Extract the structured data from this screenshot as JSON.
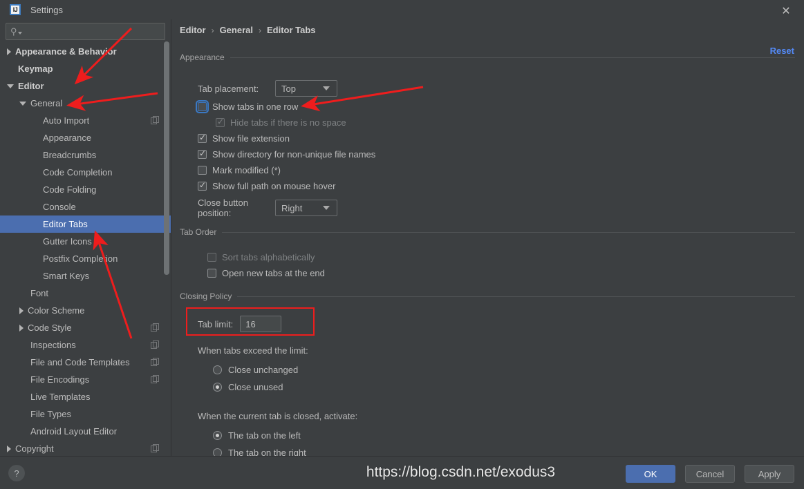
{
  "window": {
    "title": "Settings",
    "logo_text": "IJ",
    "close_icon": "close-icon"
  },
  "sidebar": {
    "search": {
      "value": "",
      "placeholder": ""
    },
    "items": [
      {
        "label": "Appearance & Behavior",
        "indent": 0,
        "twisty": "collapsed",
        "bold": true,
        "selected": false,
        "copy": false
      },
      {
        "label": "Keymap",
        "indent": 0,
        "twisty": "none",
        "bold": true,
        "selected": false,
        "copy": false
      },
      {
        "label": "Editor",
        "indent": 0,
        "twisty": "expanded",
        "bold": true,
        "selected": false,
        "copy": false
      },
      {
        "label": "General",
        "indent": 1,
        "twisty": "expanded",
        "bold": false,
        "selected": false,
        "copy": false
      },
      {
        "label": "Auto Import",
        "indent": 2,
        "twisty": "none",
        "bold": false,
        "selected": false,
        "copy": true
      },
      {
        "label": "Appearance",
        "indent": 2,
        "twisty": "none",
        "bold": false,
        "selected": false,
        "copy": false
      },
      {
        "label": "Breadcrumbs",
        "indent": 2,
        "twisty": "none",
        "bold": false,
        "selected": false,
        "copy": false
      },
      {
        "label": "Code Completion",
        "indent": 2,
        "twisty": "none",
        "bold": false,
        "selected": false,
        "copy": false
      },
      {
        "label": "Code Folding",
        "indent": 2,
        "twisty": "none",
        "bold": false,
        "selected": false,
        "copy": false
      },
      {
        "label": "Console",
        "indent": 2,
        "twisty": "none",
        "bold": false,
        "selected": false,
        "copy": false
      },
      {
        "label": "Editor Tabs",
        "indent": 2,
        "twisty": "none",
        "bold": false,
        "selected": true,
        "copy": false
      },
      {
        "label": "Gutter Icons",
        "indent": 2,
        "twisty": "none",
        "bold": false,
        "selected": false,
        "copy": false
      },
      {
        "label": "Postfix Completion",
        "indent": 2,
        "twisty": "none",
        "bold": false,
        "selected": false,
        "copy": false
      },
      {
        "label": "Smart Keys",
        "indent": 2,
        "twisty": "none",
        "bold": false,
        "selected": false,
        "copy": false
      },
      {
        "label": "Font",
        "indent": 1,
        "twisty": "none",
        "bold": false,
        "selected": false,
        "copy": false
      },
      {
        "label": "Color Scheme",
        "indent": 1,
        "twisty": "collapsed",
        "bold": false,
        "selected": false,
        "copy": false
      },
      {
        "label": "Code Style",
        "indent": 1,
        "twisty": "collapsed",
        "bold": false,
        "selected": false,
        "copy": true
      },
      {
        "label": "Inspections",
        "indent": 1,
        "twisty": "none",
        "bold": false,
        "selected": false,
        "copy": true
      },
      {
        "label": "File and Code Templates",
        "indent": 1,
        "twisty": "none",
        "bold": false,
        "selected": false,
        "copy": true
      },
      {
        "label": "File Encodings",
        "indent": 1,
        "twisty": "none",
        "bold": false,
        "selected": false,
        "copy": true
      },
      {
        "label": "Live Templates",
        "indent": 1,
        "twisty": "none",
        "bold": false,
        "selected": false,
        "copy": false
      },
      {
        "label": "File Types",
        "indent": 1,
        "twisty": "none",
        "bold": false,
        "selected": false,
        "copy": false
      },
      {
        "label": "Android Layout Editor",
        "indent": 1,
        "twisty": "none",
        "bold": false,
        "selected": false,
        "copy": false
      },
      {
        "label": "Copyright",
        "indent": 0,
        "twisty": "collapsed",
        "bold": false,
        "selected": false,
        "copy": true
      }
    ]
  },
  "content": {
    "breadcrumb": [
      "Editor",
      "General",
      "Editor Tabs"
    ],
    "breadcrumb_separator": "›",
    "reset_label": "Reset",
    "appearance": {
      "title": "Appearance",
      "tab_placement_label": "Tab placement:",
      "tab_placement_value": "Top",
      "checkboxes": [
        {
          "label": "Show tabs in one row",
          "checked": false,
          "disabled": false,
          "focused": true,
          "indent": 0
        },
        {
          "label": "Hide tabs if there is no space",
          "checked": true,
          "disabled": true,
          "focused": false,
          "indent": 1
        },
        {
          "label": "Show file extension",
          "checked": true,
          "disabled": false,
          "focused": false,
          "indent": 0
        },
        {
          "label": "Show directory for non-unique file names",
          "checked": true,
          "disabled": false,
          "focused": false,
          "indent": 0
        },
        {
          "label": "Mark modified (*)",
          "checked": false,
          "disabled": false,
          "focused": false,
          "indent": 0
        },
        {
          "label": "Show full path on mouse hover",
          "checked": true,
          "disabled": false,
          "focused": false,
          "indent": 0
        }
      ],
      "close_button_label": "Close button position:",
      "close_button_value": "Right"
    },
    "tab_order": {
      "title": "Tab Order",
      "checkboxes": [
        {
          "label": "Sort tabs alphabetically",
          "checked": false,
          "disabled": true
        },
        {
          "label": "Open new tabs at the end",
          "checked": false,
          "disabled": false
        }
      ]
    },
    "closing_policy": {
      "title": "Closing Policy",
      "tab_limit_label": "Tab limit:",
      "tab_limit_value": "16",
      "exceed_label": "When tabs exceed the limit:",
      "exceed_options": [
        {
          "label": "Close unchanged",
          "selected": false
        },
        {
          "label": "Close unused",
          "selected": true
        }
      ],
      "activate_label": "When the current tab is closed, activate:",
      "activate_options": [
        {
          "label": "The tab on the left",
          "selected": true
        },
        {
          "label": "The tab on the right",
          "selected": false
        }
      ]
    }
  },
  "footer": {
    "help_label": "?",
    "ok_label": "OK",
    "cancel_label": "Cancel",
    "apply_label": "Apply"
  },
  "overlay": {
    "watermark": "https://blog.csdn.net/exodus3",
    "annotation_color": "#ee1d1d"
  }
}
